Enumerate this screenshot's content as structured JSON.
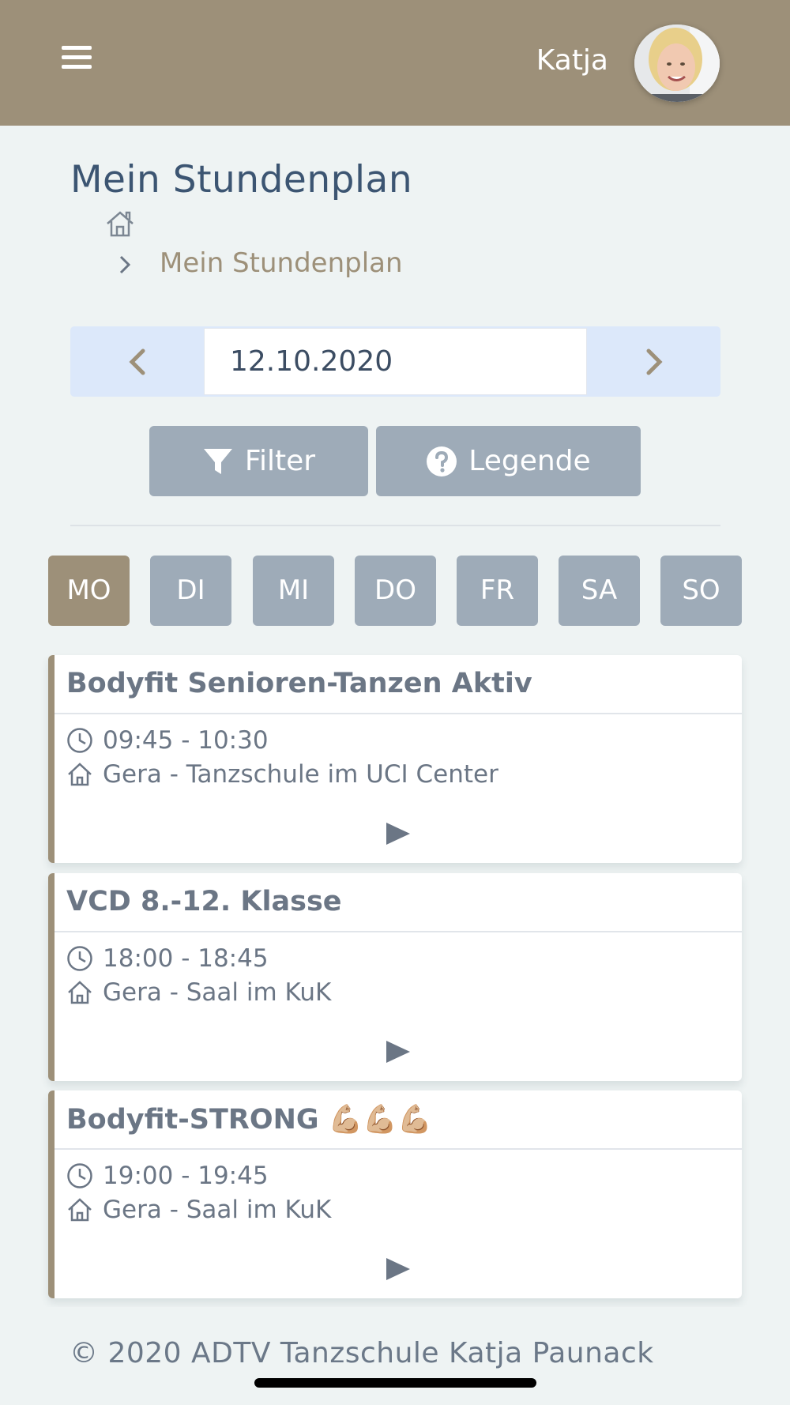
{
  "header": {
    "user_name": "Katja"
  },
  "page": {
    "title": "Mein Stundenplan",
    "breadcrumb_current": "Mein Stundenplan"
  },
  "date_nav": {
    "date": "12.10.2020"
  },
  "buttons": {
    "filter": "Filter",
    "legend": "Legende"
  },
  "days": [
    "MO",
    "DI",
    "MI",
    "DO",
    "FR",
    "SA",
    "SO"
  ],
  "active_day": "MO",
  "courses": [
    {
      "title": "Bodyfit Senioren-Tanzen Aktiv",
      "time": "09:45 - 10:30",
      "location": "Gera - Tanzschule im UCI Center"
    },
    {
      "title": "VCD 8.-12. Klasse",
      "time": "18:00 - 18:45",
      "location": "Gera - Saal im KuK"
    },
    {
      "title": "Bodyfit-STRONG 💪🏼💪🏼💪🏼",
      "time": "19:00 - 19:45",
      "location": "Gera - Saal im KuK"
    }
  ],
  "footer": {
    "text": "© 2020 ADTV Tanzschule Katja Paunack"
  },
  "colors": {
    "brand": "#9d9079",
    "button": "#9eabb8",
    "title": "#3c5572",
    "date_nav_bg": "#dce8fa"
  }
}
